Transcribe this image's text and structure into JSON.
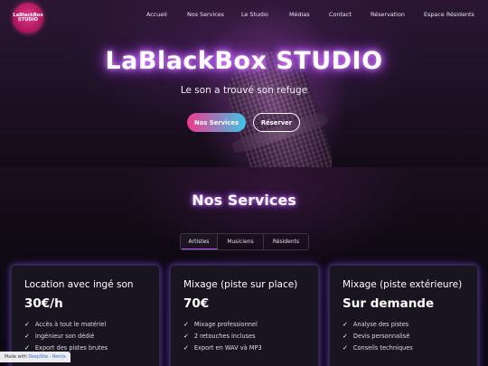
{
  "brand": {
    "logo_line1": "LaBlackBox",
    "logo_line2": "STUDIO"
  },
  "nav": [
    {
      "label": "Accueil"
    },
    {
      "label": "Nos Services"
    },
    {
      "label": "Le Studio"
    },
    {
      "label": "Médias"
    },
    {
      "label": "Contact"
    },
    {
      "label": "Réservation"
    },
    {
      "label": "Espace Résidents"
    }
  ],
  "hero": {
    "title": "LaBlackBox STUDIO",
    "subtitle": "Le son a trouvé son refuge",
    "primary_button": "Nos Services",
    "secondary_button": "Réserver"
  },
  "services": {
    "title": "Nos Services",
    "tabs": [
      {
        "label": "Artistes"
      },
      {
        "label": "Musiciens"
      },
      {
        "label": "Résidents"
      }
    ],
    "cards": [
      {
        "title": "Location avec ingé son",
        "price": "30€/h",
        "features": [
          "Accès à tout le matériel",
          "Ingénieur son dédié",
          "Export des pistes brutes"
        ]
      },
      {
        "title": "Mixage (piste sur place)",
        "price": "70€",
        "features": [
          "Mixage professionnel",
          "2 retouches incluses",
          "Export en WAV và MP3"
        ]
      },
      {
        "title": "Mixage (piste extérieure)",
        "price": "Sur demande",
        "features": [
          "Analyse des pistes",
          "Devis personnalisé",
          "Conseils techniques"
        ]
      }
    ]
  },
  "footer_badge": {
    "text": "Made with",
    "link1": "DeepSite",
    "sep": "-",
    "link2": "Remix"
  },
  "colors": {
    "accent_pink": "#f0388e",
    "accent_cyan": "#3ec4e6",
    "glow_purple": "#a040ff"
  },
  "icons": {
    "check": "check-icon"
  }
}
